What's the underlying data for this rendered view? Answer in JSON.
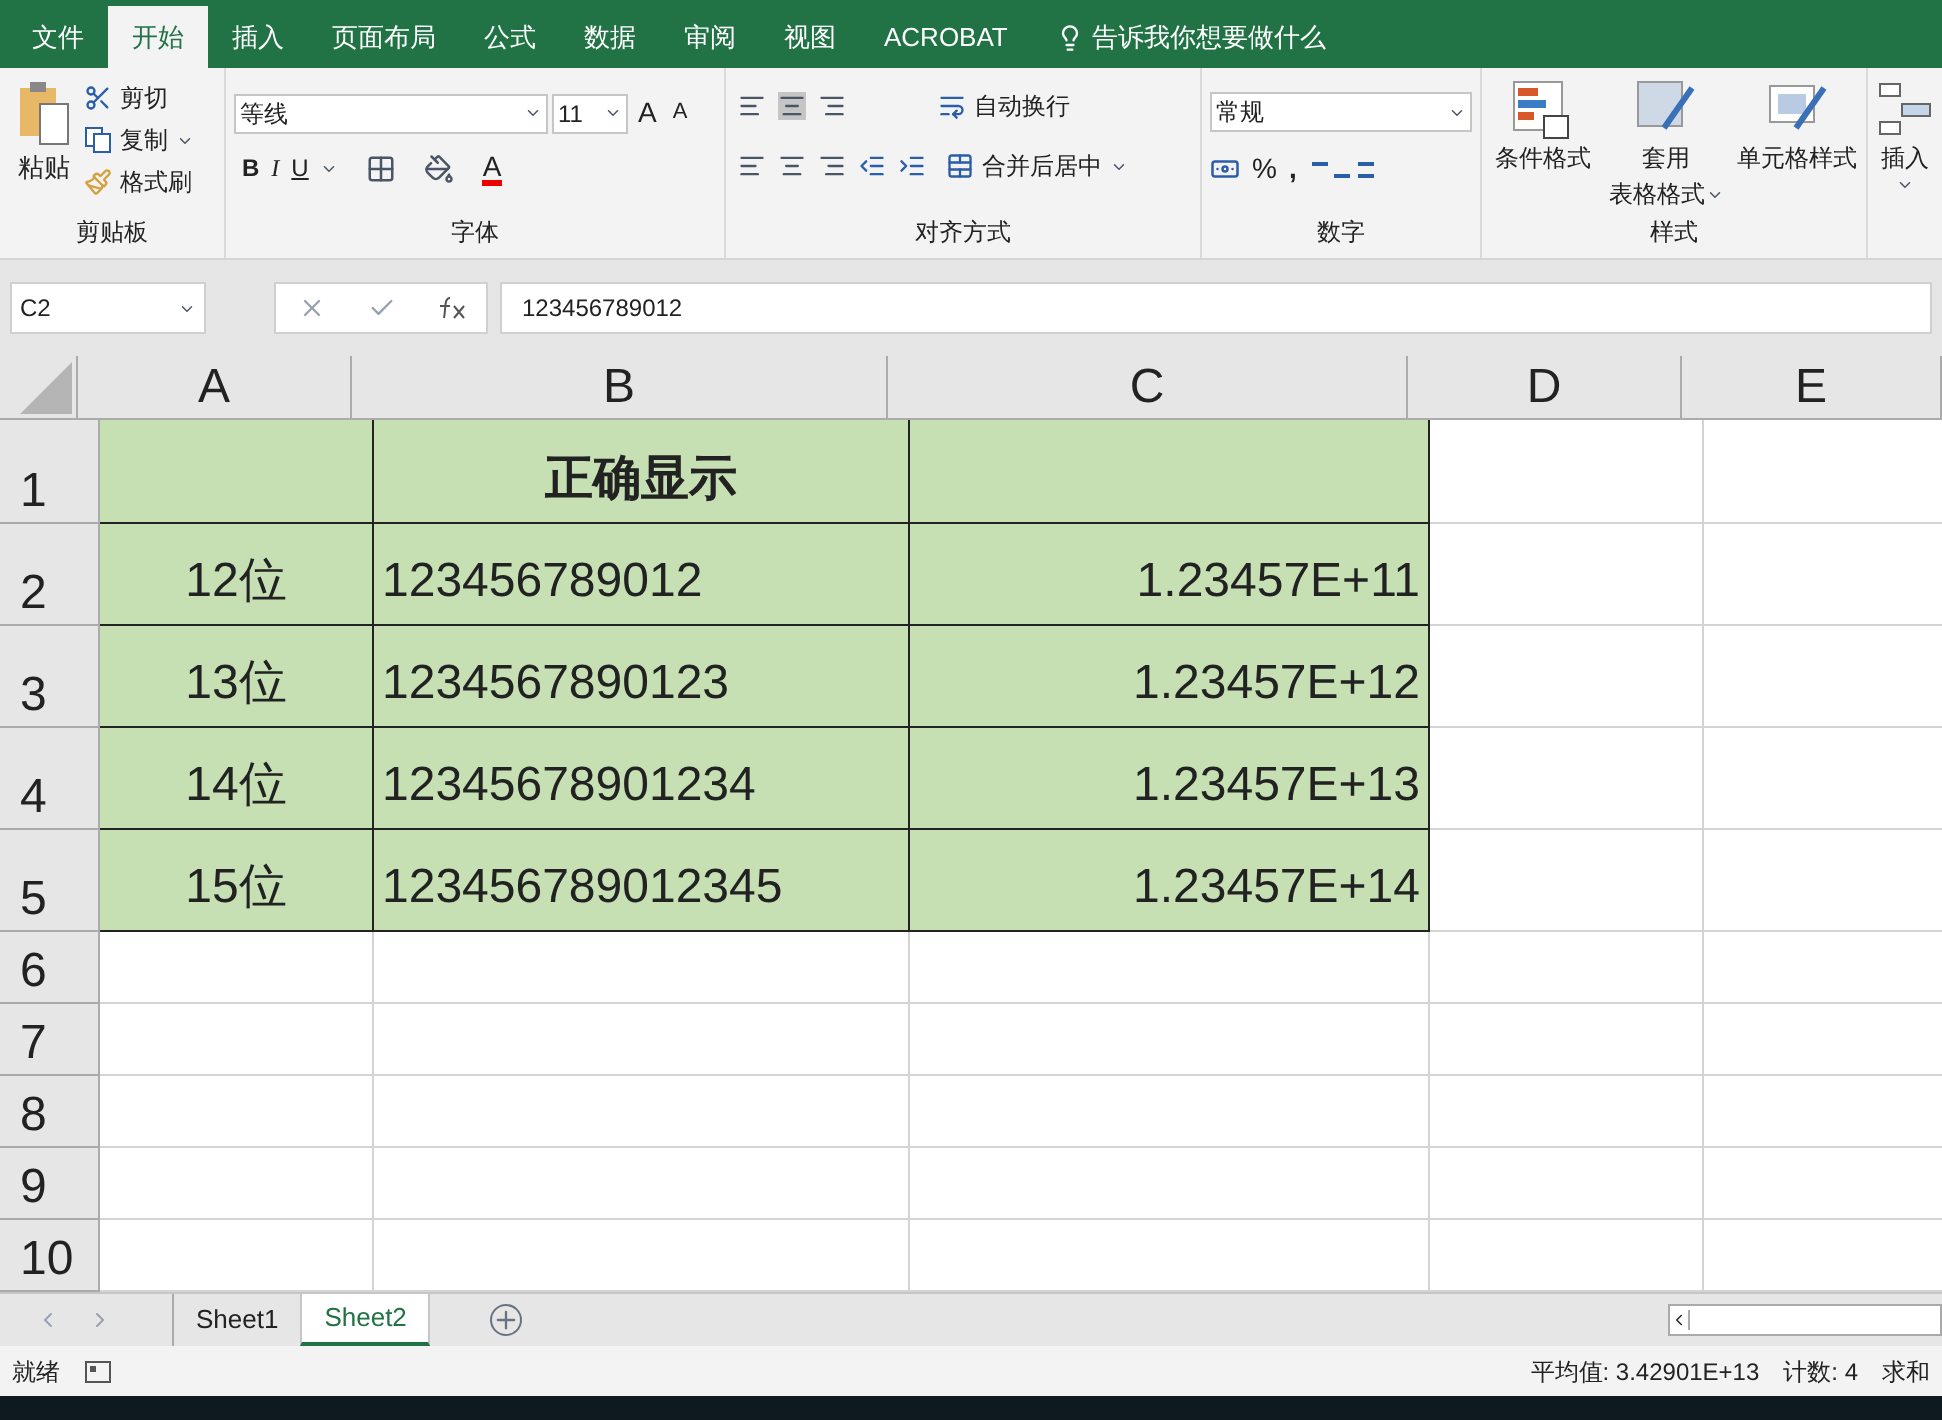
{
  "menu_tabs": [
    {
      "label": "文件",
      "selected": false
    },
    {
      "label": "开始",
      "selected": true
    },
    {
      "label": "插入",
      "selected": false
    },
    {
      "label": "页面布局",
      "selected": false
    },
    {
      "label": "公式",
      "selected": false
    },
    {
      "label": "数据",
      "selected": false
    },
    {
      "label": "审阅",
      "selected": false
    },
    {
      "label": "视图",
      "selected": false
    },
    {
      "label": "ACROBAT",
      "selected": false
    }
  ],
  "tell_me": "告诉我你想要做什么",
  "ribbon": {
    "clipboard": {
      "paste": "粘贴",
      "cut": "剪切",
      "copy": "复制",
      "format_painter": "格式刷",
      "label": "剪贴板"
    },
    "font": {
      "name": "等线",
      "size": "11",
      "grow": "A",
      "shrink": "A",
      "style_buttons": [
        "B",
        "I",
        "U"
      ],
      "font_color": "A",
      "label": "字体"
    },
    "alignment": {
      "wrap": "自动换行",
      "merge": "合并后居中",
      "label": "对齐方式"
    },
    "number": {
      "format": "常规",
      "percent": "%",
      "comma": ",",
      "label": "数字"
    },
    "styles": {
      "conditional": "条件格式",
      "table_format_1": "套用",
      "table_format_2": "表格格式",
      "cell_styles": "单元格样式",
      "label": "样式"
    },
    "cells": {
      "insert": "插入"
    }
  },
  "name_box": "C2",
  "formula": "123456789012",
  "columns": [
    "A",
    "B",
    "C",
    "D",
    "E"
  ],
  "rows": [
    {
      "number": "1",
      "cells": [
        {
          "kind": "blank",
          "filled": true
        },
        {
          "kind": "title",
          "text": "正确显示",
          "filled": true
        },
        {
          "kind": "blank",
          "filled": true
        }
      ]
    },
    {
      "number": "2",
      "cells": [
        {
          "kind": "label",
          "text": "12位",
          "filled": true
        },
        {
          "kind": "text",
          "text": "123456789012",
          "filled": true
        },
        {
          "kind": "number",
          "text": "1.23457E+11",
          "filled": true
        }
      ]
    },
    {
      "number": "3",
      "cells": [
        {
          "kind": "label",
          "text": "13位",
          "filled": true
        },
        {
          "kind": "text",
          "text": "1234567890123",
          "filled": true
        },
        {
          "kind": "number",
          "text": "1.23457E+12",
          "filled": true
        }
      ]
    },
    {
      "number": "4",
      "cells": [
        {
          "kind": "label",
          "text": "14位",
          "filled": true
        },
        {
          "kind": "text",
          "text": "12345678901234",
          "filled": true
        },
        {
          "kind": "number",
          "text": "1.23457E+13",
          "filled": true
        }
      ]
    },
    {
      "number": "5",
      "cells": [
        {
          "kind": "label",
          "text": "15位",
          "filled": true
        },
        {
          "kind": "text",
          "text": "123456789012345",
          "filled": true
        },
        {
          "kind": "number",
          "text": "1.23457E+14",
          "filled": true
        }
      ]
    },
    {
      "number": "6",
      "cells": []
    },
    {
      "number": "7",
      "cells": []
    },
    {
      "number": "8",
      "cells": []
    },
    {
      "number": "9",
      "cells": []
    },
    {
      "number": "10",
      "cells": []
    }
  ],
  "sheet_tabs": [
    {
      "label": "Sheet1",
      "selected": false
    },
    {
      "label": "Sheet2",
      "selected": true
    }
  ],
  "status": {
    "mode": "就绪",
    "average": "平均值: 3.42901E+13",
    "count": "计数: 4",
    "sum": "求和"
  }
}
